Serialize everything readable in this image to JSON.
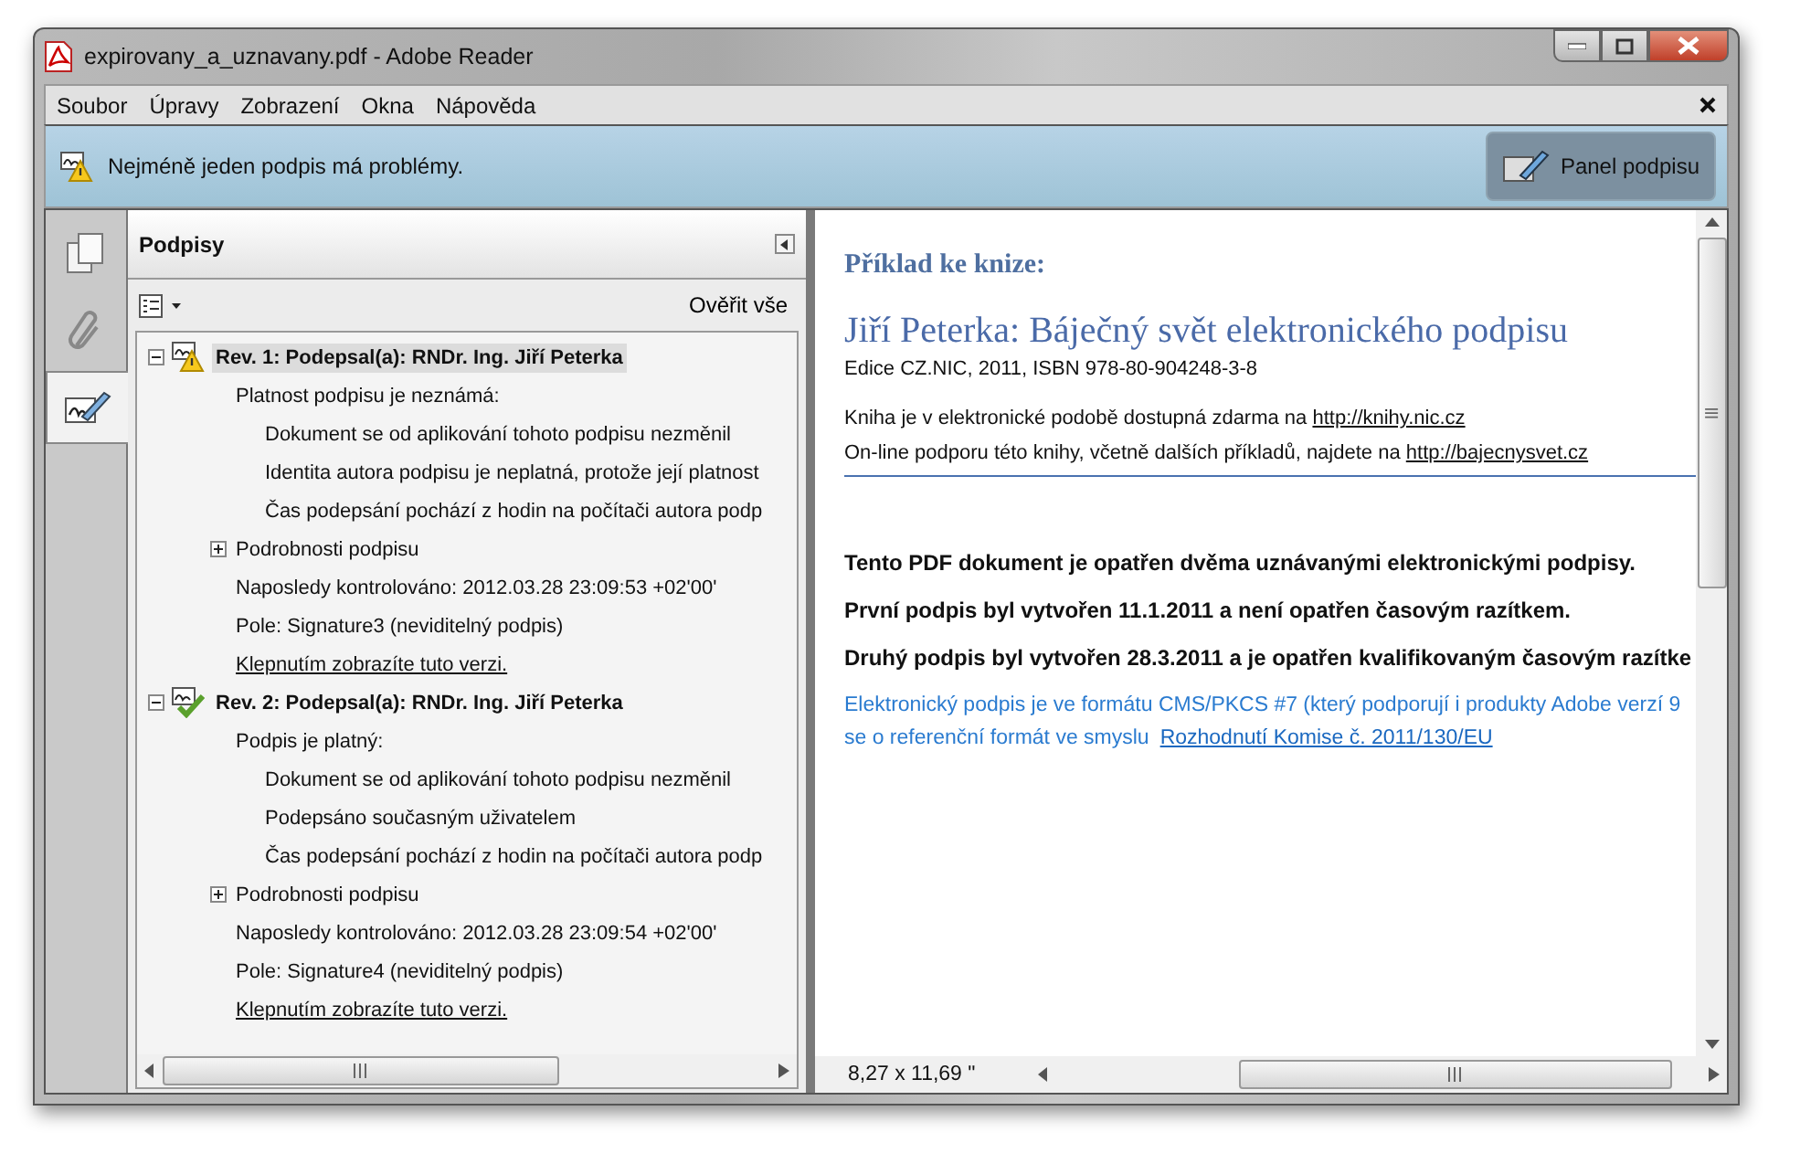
{
  "window": {
    "title": "expirovany_a_uznavany.pdf - Adobe Reader"
  },
  "menu": [
    "Soubor",
    "Úpravy",
    "Zobrazení",
    "Okna",
    "Nápověda"
  ],
  "notification": {
    "text": "Nejméně jeden podpis má problémy.",
    "button": "Panel podpisu"
  },
  "side_tabs": [
    {
      "kind": "pages",
      "selected": false
    },
    {
      "kind": "attachments",
      "selected": false
    },
    {
      "kind": "signatures",
      "selected": true
    }
  ],
  "panel": {
    "title": "Podpisy",
    "verify_all": "Ověřit vše"
  },
  "signatures": [
    {
      "title": "Rev. 1: Podepsal(a): RNDr. Ing. Jiří Peterka",
      "kind": "warning",
      "expanded": true,
      "selected": true,
      "status_text": "Platnost podpisu je neznámá:",
      "items": [
        "Dokument se od aplikování tohoto podpisu nezměnil",
        "Identita autora podpisu je neplatná, protože její platnost",
        "Čas podepsání pochází z hodin na počítači autora podp"
      ],
      "details": {
        "label": "Podrobnosti podpisu",
        "expanded": false
      },
      "checked": "Naposledy kontrolováno: 2012.03.28 23:09:53 +02'00'",
      "field": "Pole: Signature3 (neviditelný podpis)",
      "link": "Klepnutím zobrazíte tuto verzi."
    },
    {
      "title": "Rev. 2: Podepsal(a): RNDr. Ing. Jiří Peterka",
      "kind": "valid",
      "expanded": true,
      "selected": false,
      "status_text": "Podpis je platný:",
      "items": [
        "Dokument se od aplikování tohoto podpisu nezměnil",
        "Podepsáno současným uživatelem",
        "Čas podepsání pochází z hodin na počítači autora podp"
      ],
      "details": {
        "label": "Podrobnosti podpisu",
        "expanded": false
      },
      "checked": "Naposledy kontrolováno: 2012.03.28 23:09:54 +02'00'",
      "field": "Pole: Signature4 (neviditelný podpis)",
      "link": "Klepnutím zobrazíte tuto verzi."
    }
  ],
  "document": {
    "kicker": "Příklad ke knize:",
    "title": "Jiří Peterka: Báječný svět elektronického podpisu",
    "edition": "Edice CZ.NIC, 2011, ISBN 978-80-904248-3-8",
    "links": [
      {
        "text": "Kniha je v elektronické podobě dostupná zdarma na",
        "url": "http://knihy.nic.cz"
      },
      {
        "text": "On-line podporu této knihy, včetně dalších příkladů, najdete na",
        "url": "http://bajecnysvet.cz"
      }
    ],
    "statements": [
      "Tento PDF dokument je opatřen dvěma uznávanými elektronickými podpisy.",
      "První podpis byl vytvořen 11.1.2011 a není opatřen časovým razítkem.",
      "Druhý podpis byl vytvořen 28.3.2011 a je opatřen kvalifikovaným časovým razítke"
    ],
    "note_lines": [
      "Elektronický podpis je ve formátu CMS/PKCS #7 (který podporují i produkty Adobe verzí  9",
      "se o referenční formát ve smyslu"
    ],
    "note_link": "Rozhodnutí Komise č. 2011/130/EU"
  },
  "status_bar": {
    "page_size": "8,27 x 11,69 \""
  }
}
